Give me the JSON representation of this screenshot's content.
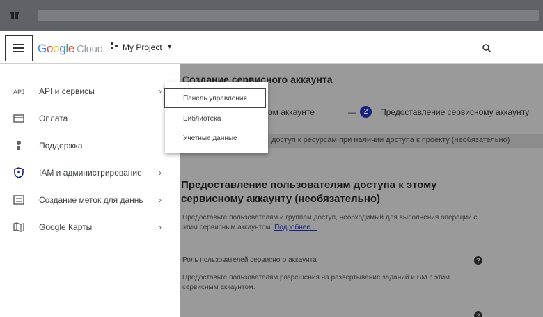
{
  "header": {
    "logo_google": [
      "G",
      "o",
      "o",
      "g",
      "l",
      "e"
    ],
    "logo_cloud": "Cloud",
    "project_name": "My Project",
    "project_caret": "▼"
  },
  "sidebar": {
    "items": [
      {
        "icon": "api-icon",
        "label": "API и сервисы",
        "chevron": "›"
      },
      {
        "icon": "billing-icon",
        "label": "Оплата",
        "chevron": ""
      },
      {
        "icon": "support-icon",
        "label": "Поддержка",
        "chevron": ""
      },
      {
        "icon": "iam-shield-icon",
        "label": "IAM и администрирование",
        "chevron": "›"
      },
      {
        "icon": "labeling-icon",
        "label": "Создание меток для данных",
        "chevron": "›"
      },
      {
        "icon": "maps-icon",
        "label": "Google Карты",
        "chevron": "›"
      }
    ]
  },
  "submenu": {
    "items": [
      {
        "label": "Панель управления",
        "active": true
      },
      {
        "label": "Библиотека",
        "active": false
      },
      {
        "label": "Учетные данные",
        "active": false
      }
    ]
  },
  "content": {
    "step_title": "Создание сервисного аккаунта",
    "row1_left": "вном аккаунте",
    "row1_arrow": "—",
    "step_number": "2",
    "row1_right": "Предоставление сервисному аккаунту",
    "strip_text": "доступ к ресурсам при наличии доступа к проекту (необязательно)",
    "section_title": "Предоставление пользователям доступа к этому сервисному аккаунту (необязательно)",
    "desc_text": "Предоставьте пользователям и группам доступ, необходимый для выполнения операций с этим сервисным аккаунтом.",
    "desc_link": "Подробнее…",
    "field_label": "Роль пользователей сервисного аккаунта",
    "field_hint": "Предоставьте пользователям разрешения на развертывание заданий и ВМ с этим сервисным аккаунтом.",
    "help_glyph": "?"
  },
  "colors": {
    "accent": "#1a237e",
    "overlay": "#9a9a9a"
  }
}
